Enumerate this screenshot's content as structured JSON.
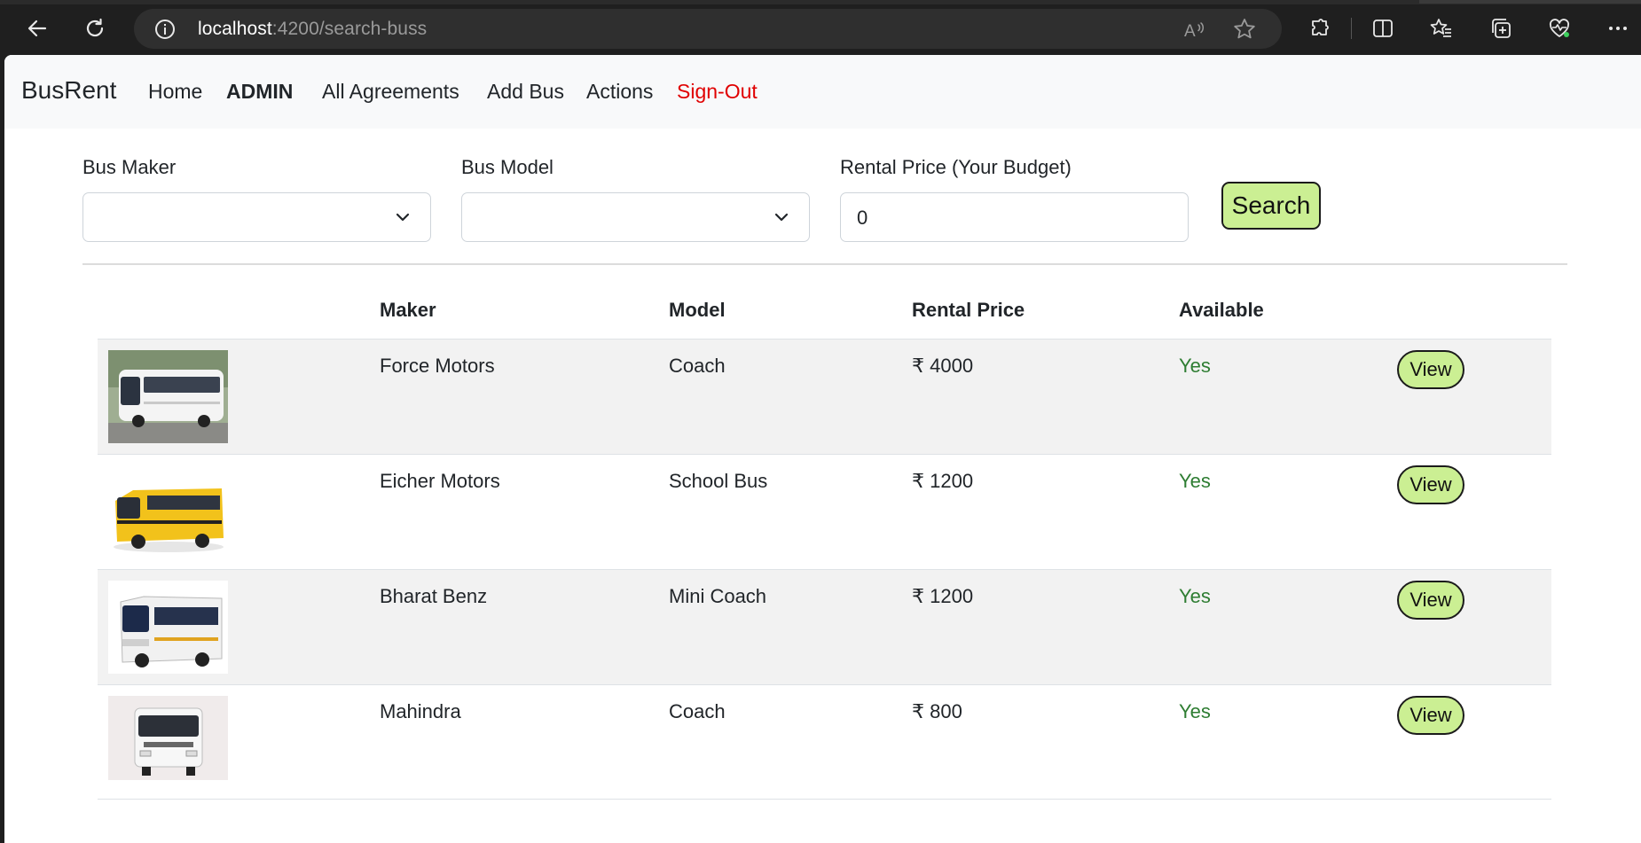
{
  "browser": {
    "url_host": "localhost",
    "url_path": ":4200/search-buss"
  },
  "navbar": {
    "brand": "BusRent",
    "links": [
      "Home",
      "ADMIN",
      "All Agreements",
      "Add Bus",
      "Actions",
      "Sign-Out"
    ]
  },
  "filters": {
    "maker_label": "Bus Maker",
    "maker_value": "",
    "model_label": "Bus Model",
    "model_value": "",
    "price_label": "Rental Price (Your Budget)",
    "price_value": "0",
    "search_label": "Search"
  },
  "table": {
    "headers": [
      "Maker",
      "Model",
      "Rental Price",
      "Available"
    ],
    "rows": [
      {
        "maker": "Force Motors",
        "model": "Coach",
        "price": "₹ 4000",
        "available": "Yes",
        "action": "View",
        "image": "white-coach-bus"
      },
      {
        "maker": "Eicher Motors",
        "model": "School Bus",
        "price": "₹ 1200",
        "available": "Yes",
        "action": "View",
        "image": "yellow-school-bus"
      },
      {
        "maker": "Bharat Benz",
        "model": "Mini Coach",
        "price": "₹ 1200",
        "available": "Yes",
        "action": "View",
        "image": "white-mini-coach"
      },
      {
        "maker": "Mahindra",
        "model": "Coach",
        "price": "₹ 800",
        "available": "Yes",
        "action": "View",
        "image": "white-bus-front"
      }
    ]
  },
  "colors": {
    "accent_button": "#cbef93",
    "available_text": "#2e7d32",
    "signout_text": "#e00000"
  }
}
